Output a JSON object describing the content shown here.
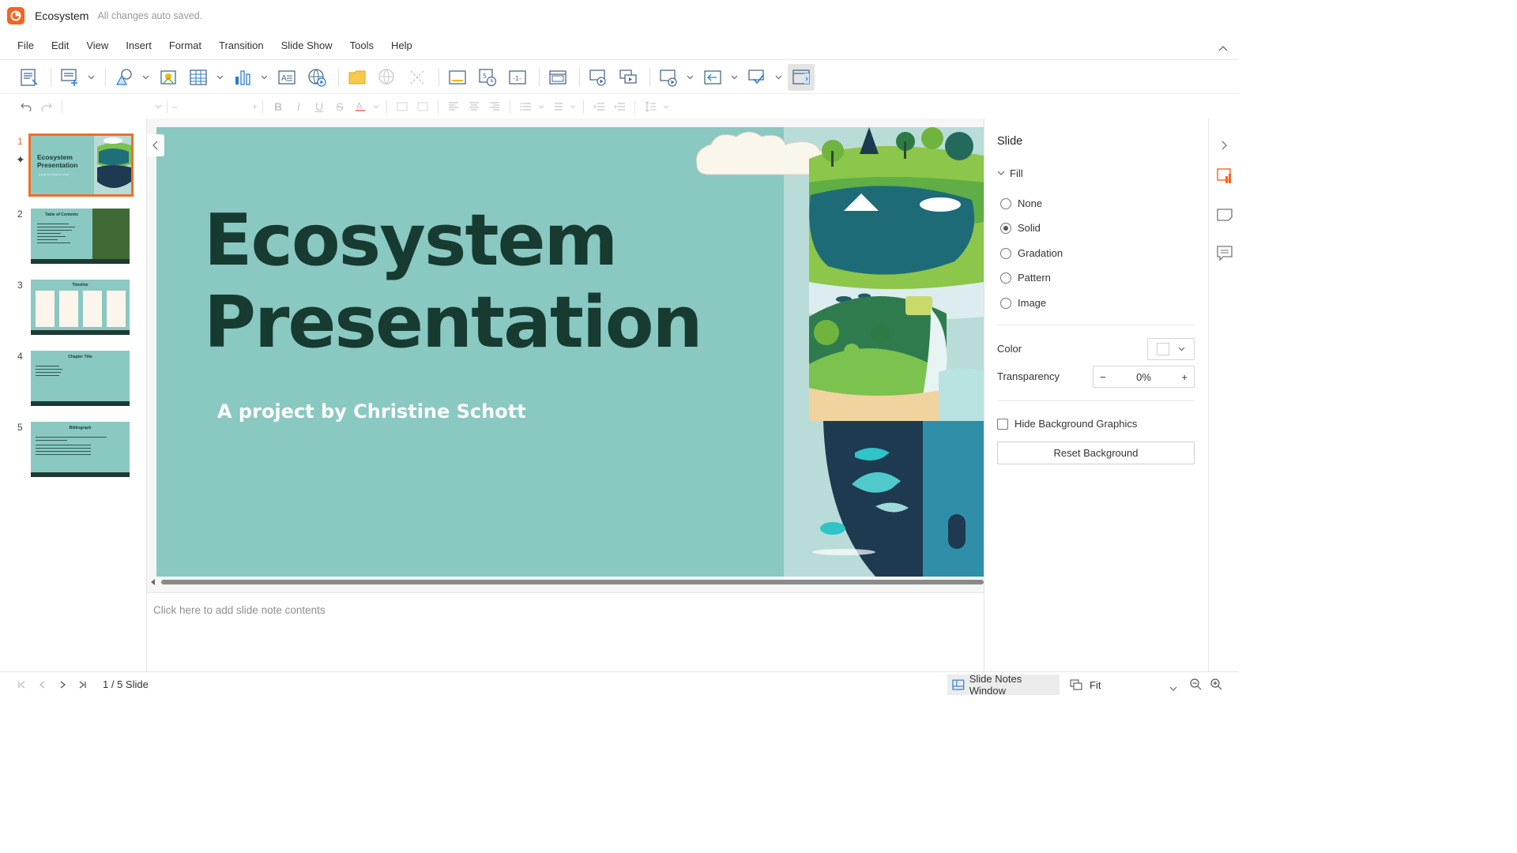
{
  "app": {
    "doc_title": "Ecosystem",
    "save_status": "All changes auto saved.",
    "accent_color": "#f26522"
  },
  "menu": {
    "items": [
      "File",
      "Edit",
      "View",
      "Insert",
      "Format",
      "Transition",
      "Slide Show",
      "Tools",
      "Help"
    ]
  },
  "toolbar": {
    "icons": [
      "new-slide-icon",
      "add-slide-icon",
      "shapes-icon",
      "image-icon",
      "table-icon",
      "chart-icon",
      "text-box-icon",
      "web-video-icon",
      "sticky-note-icon",
      "globe-icon",
      "diagonal-icon",
      "header-footer-icon",
      "date-time-icon",
      "slide-number-icon",
      "slide-layout-icon",
      "play-from-start-icon",
      "play-current-icon",
      "present-icon",
      "back-icon",
      "comment-icon",
      "sidebar-toggle-icon"
    ]
  },
  "thumbnails": [
    {
      "number": "1",
      "title": "Ecosystem\nPresentation",
      "subtitle": "A project by Christine Schott",
      "selected": true
    },
    {
      "number": "2",
      "title": "Table of Contents",
      "selected": false
    },
    {
      "number": "3",
      "title": "Timeline",
      "selected": false
    },
    {
      "number": "4",
      "title": "Chapter Title",
      "selected": false
    },
    {
      "number": "5",
      "title": "Bibliograph",
      "selected": false
    }
  ],
  "slide": {
    "title": "Ecosystem\nPresentation",
    "subtitle": "A project by Christine Schott",
    "background_color": "#8ac8c2",
    "title_color": "#173b31"
  },
  "notes": {
    "placeholder": "Click here to add slide note contents"
  },
  "panel": {
    "title": "Slide",
    "fill_label": "Fill",
    "fill_options": [
      {
        "label": "None",
        "checked": false
      },
      {
        "label": "Solid",
        "checked": true
      },
      {
        "label": "Gradation",
        "checked": false
      },
      {
        "label": "Pattern",
        "checked": false
      },
      {
        "label": "Image",
        "checked": false
      }
    ],
    "color_label": "Color",
    "transparency_label": "Transparency",
    "transparency_value": "0%",
    "hide_bg_label": "Hide Background Graphics",
    "hide_bg_checked": false,
    "reset_label": "Reset Background"
  },
  "status": {
    "slide_counter": "1 / 5 Slide",
    "notes_window_label": "Slide Notes Window",
    "zoom_label": "Fit"
  }
}
